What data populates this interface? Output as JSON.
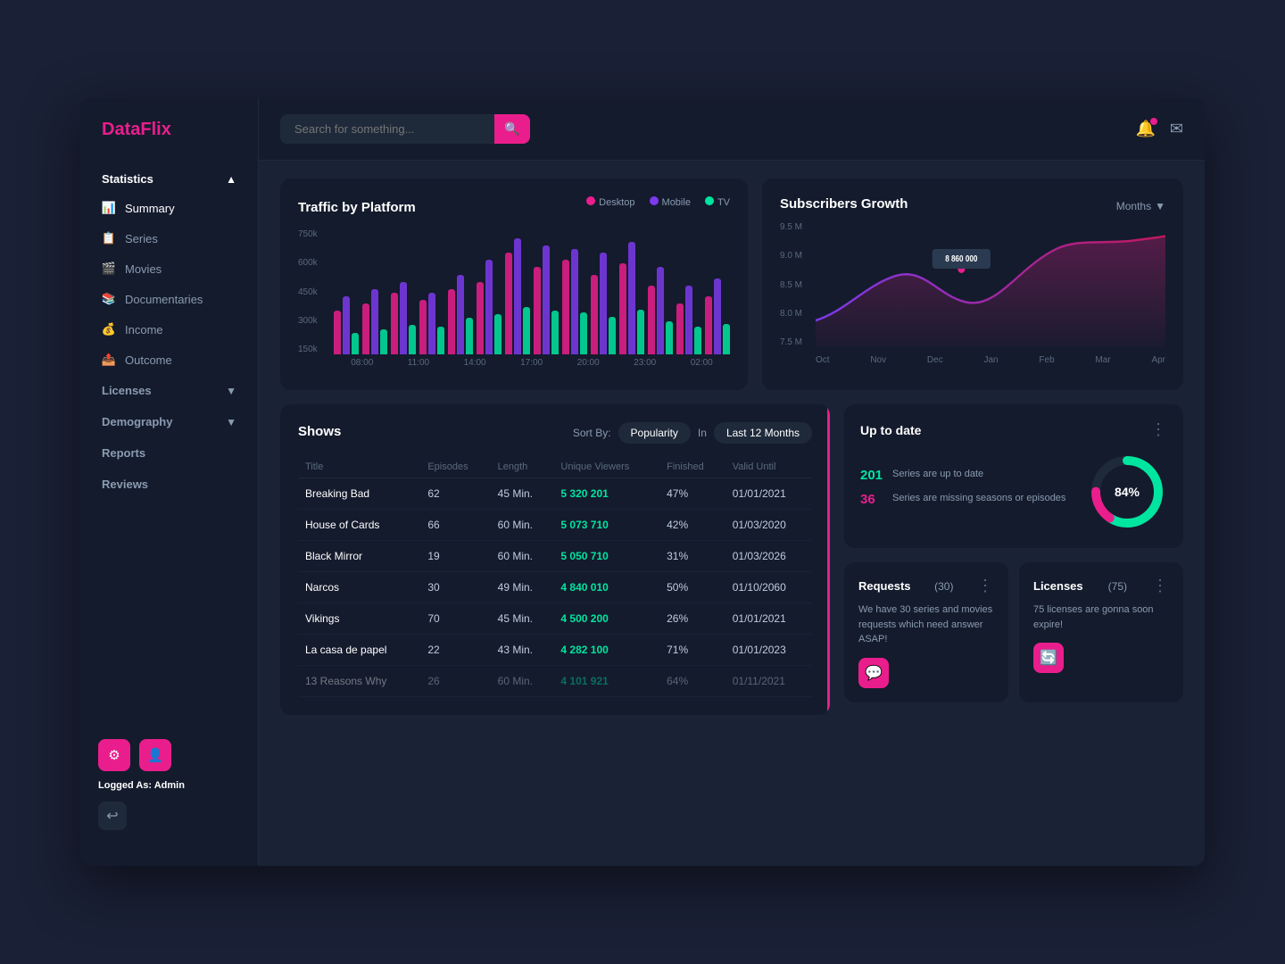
{
  "app": {
    "name_prefix": "Data",
    "name_suffix": "Flix"
  },
  "sidebar": {
    "statistics_label": "Statistics",
    "statistics_chevron": "▲",
    "items": [
      {
        "id": "summary",
        "label": "Summary",
        "icon": "📊",
        "active": true
      },
      {
        "id": "series",
        "label": "Series",
        "icon": "📋",
        "active": false
      },
      {
        "id": "movies",
        "label": "Movies",
        "icon": "🎬",
        "active": false
      },
      {
        "id": "documentaries",
        "label": "Documentaries",
        "icon": "📚",
        "active": false
      },
      {
        "id": "income",
        "label": "Income",
        "icon": "💰",
        "active": false
      },
      {
        "id": "outcome",
        "label": "Outcome",
        "icon": "📤",
        "active": false
      }
    ],
    "licenses_label": "Licenses",
    "demography_label": "Demography",
    "reports_label": "Reports",
    "reviews_label": "Reviews",
    "logged_as_prefix": "Logged As: ",
    "logged_as_user": "Admin"
  },
  "topbar": {
    "search_placeholder": "Search for something...",
    "search_icon": "🔍"
  },
  "traffic_chart": {
    "title": "Traffic by Platform",
    "legend": [
      {
        "label": "Desktop",
        "color": "#e91e8c"
      },
      {
        "label": "Mobile",
        "color": "#7c3aed"
      },
      {
        "label": "TV",
        "color": "#00e5a0"
      }
    ],
    "y_labels": [
      "750k",
      "600k",
      "450k",
      "300k",
      "150k",
      ""
    ],
    "x_labels": [
      "08:00",
      "11:00",
      "14:00",
      "17:00",
      "20:00",
      "23:00",
      "02:00"
    ],
    "bar_groups": [
      [
        60,
        80,
        30
      ],
      [
        70,
        90,
        35
      ],
      [
        85,
        100,
        40
      ],
      [
        75,
        85,
        38
      ],
      [
        90,
        110,
        50
      ],
      [
        100,
        130,
        55
      ],
      [
        140,
        160,
        65
      ],
      [
        120,
        150,
        60
      ],
      [
        130,
        145,
        58
      ],
      [
        110,
        140,
        52
      ],
      [
        125,
        155,
        62
      ],
      [
        95,
        120,
        45
      ],
      [
        70,
        95,
        38
      ],
      [
        80,
        105,
        42
      ]
    ]
  },
  "subscribers_chart": {
    "title": "Subscribers Growth",
    "months_label": "Months",
    "tooltip_value": "8 860 000",
    "y_labels": [
      "9.5 M",
      "9.0 M",
      "8.5 M",
      "8.0 M",
      "7.5 M"
    ],
    "x_labels": [
      "Oct",
      "Nov",
      "Dec",
      "Jan",
      "Feb",
      "Mar",
      "Apr"
    ]
  },
  "shows": {
    "title": "Shows",
    "sort_by_label": "Sort By:",
    "sort_option": "Popularity",
    "in_label": "In",
    "filter_label": "Last 12 Months",
    "columns": [
      "Title",
      "Episodes",
      "Length",
      "Unique Viewers",
      "Finished",
      "Valid Until"
    ],
    "rows": [
      {
        "title": "Breaking Bad",
        "episodes": "62",
        "length": "45 Min.",
        "viewers": "5 320 201",
        "finished": "47%",
        "valid": "01/01/2021"
      },
      {
        "title": "House of Cards",
        "episodes": "66",
        "length": "60 Min.",
        "viewers": "5 073 710",
        "finished": "42%",
        "valid": "01/03/2020"
      },
      {
        "title": "Black Mirror",
        "episodes": "19",
        "length": "60 Min.",
        "viewers": "5 050 710",
        "finished": "31%",
        "valid": "01/03/2026"
      },
      {
        "title": "Narcos",
        "episodes": "30",
        "length": "49 Min.",
        "viewers": "4 840 010",
        "finished": "50%",
        "valid": "01/10/2060"
      },
      {
        "title": "Vikings",
        "episodes": "70",
        "length": "45 Min.",
        "viewers": "4 500 200",
        "finished": "26%",
        "valid": "01/01/2021"
      },
      {
        "title": "La casa de papel",
        "episodes": "22",
        "length": "43 Min.",
        "viewers": "4 282 100",
        "finished": "71%",
        "valid": "01/01/2023"
      },
      {
        "title": "13 Reasons Why",
        "episodes": "26",
        "length": "60 Min.",
        "viewers": "4 101 921",
        "finished": "64%",
        "valid": "01/11/2021"
      }
    ]
  },
  "uptodate": {
    "title": "Up to date",
    "percent": "84%",
    "stat1_num": "201",
    "stat1_desc": "Series are up to date",
    "stat2_num": "36",
    "stat2_desc": "Series are missing seasons or episodes",
    "donut_green": 84,
    "donut_pink": 16
  },
  "requests_card": {
    "title": "Requests",
    "count": "(30)",
    "body": "We have 30 series and movies requests which need answer ASAP!",
    "btn_icon": "💬"
  },
  "licenses_card": {
    "title": "Licenses",
    "count": "(75)",
    "body": "75 licenses are gonna soon expire!",
    "btn_icon": "🔄"
  }
}
